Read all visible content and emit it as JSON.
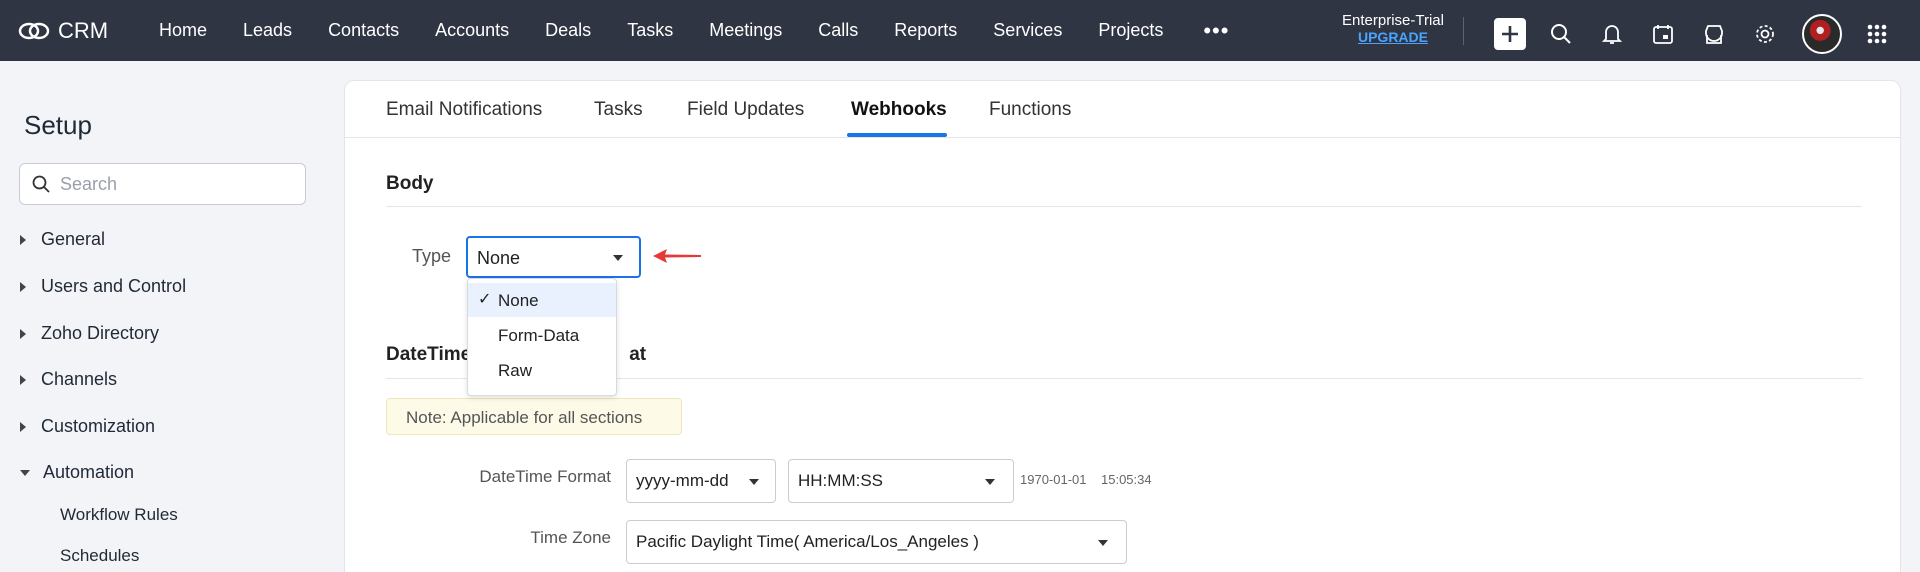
{
  "app": {
    "name": "CRM"
  },
  "nav": {
    "items": [
      "Home",
      "Leads",
      "Contacts",
      "Accounts",
      "Deals",
      "Tasks",
      "Meetings",
      "Calls",
      "Reports",
      "Services",
      "Projects"
    ],
    "more": "•••"
  },
  "plan": {
    "edition": "Enterprise-Trial",
    "upgrade": "UPGRADE"
  },
  "sidebar": {
    "title": "Setup",
    "search_placeholder": "Search",
    "items": [
      {
        "label": "General",
        "expanded": false
      },
      {
        "label": "Users and Control",
        "expanded": false
      },
      {
        "label": "Zoho Directory",
        "expanded": false
      },
      {
        "label": "Channels",
        "expanded": false
      },
      {
        "label": "Customization",
        "expanded": false
      },
      {
        "label": "Automation",
        "expanded": true
      }
    ],
    "subitems": [
      "Workflow Rules",
      "Schedules"
    ]
  },
  "tabs": [
    {
      "label": "Email Notifications",
      "active": false
    },
    {
      "label": "Tasks",
      "active": false
    },
    {
      "label": "Field Updates",
      "active": false
    },
    {
      "label": "Webhooks",
      "active": true
    },
    {
      "label": "Functions",
      "active": false
    }
  ],
  "body_section": {
    "title": "Body",
    "type_label": "Type",
    "type_value": "None",
    "options": [
      "None",
      "Form-Data",
      "Raw"
    ],
    "selected_option": "None",
    "check_mark": "✓"
  },
  "datetime_section": {
    "title_left": "DateTime",
    "title_right": "at",
    "note": "Note: Applicable for all sections",
    "format_label": "DateTime Format",
    "date_format": "yyyy-mm-dd",
    "time_format": "HH:MM:SS",
    "preview_date": "1970-01-01",
    "preview_time": "15:05:34",
    "timezone_label": "Time Zone",
    "timezone_value": "Pacific Daylight Time( America/Los_Angeles )"
  },
  "colors": {
    "topbar": "#2f3542",
    "accent": "#1a73e8",
    "arrow": "#e53935",
    "upgrade": "#4aa3ff"
  }
}
